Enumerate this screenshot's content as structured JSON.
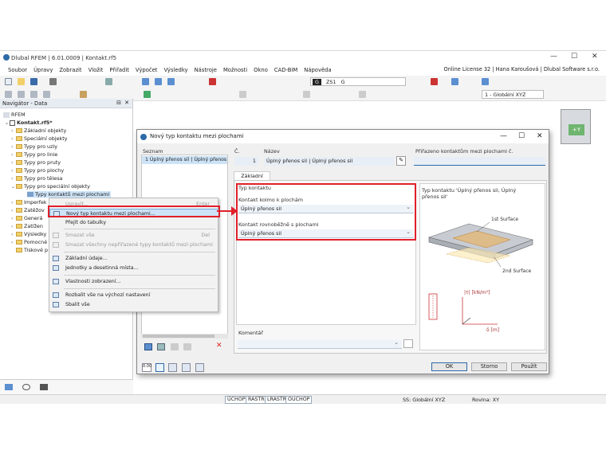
{
  "app": {
    "title": "Dlubal RFEM | 6.01.0009 | Kontakt.rf5",
    "license": "Online License 32 | Hana Karoušová | Dlubal Software s.r.o.",
    "window_controls": [
      "—",
      "☐",
      "✕"
    ]
  },
  "menu": [
    "Soubor",
    "Úpravy",
    "Zobrazit",
    "Vložit",
    "Přiřadit",
    "Výpočet",
    "Výsledky",
    "Nástroje",
    "Možnosti",
    "Okno",
    "CAD-BIM",
    "Nápověda"
  ],
  "toolbar": {
    "load_case": "G",
    "load_case_id": "ZS1",
    "load_case_name": "G",
    "coord_system": "1 - Globální XYZ"
  },
  "navigator": {
    "title": "Navigátor - Data",
    "root": "RFEM",
    "file": "Kontakt.rf5*",
    "items": [
      "Základní objekty",
      "Speciální objekty",
      "Typy pro uzly",
      "Typy pro linie",
      "Typy pro pruty",
      "Typy pro plochy",
      "Typy pro tělesa",
      "Typy pro speciální objekty",
      "Typy kontaktů mezi plochami",
      "Imperfek",
      "Zatěžov",
      "Generá",
      "Zatížen",
      "Výsledky",
      "Pomocné",
      "Tiskové p"
    ]
  },
  "context_menu": {
    "items": [
      {
        "label": "Upravit...",
        "shortcut": "Enter",
        "disabled": true
      },
      {
        "label": "Nový typ kontaktu mezi plochami...",
        "shortcut": "",
        "disabled": false,
        "highlighted": true
      },
      {
        "label": "Přejít do tabulky",
        "shortcut": "",
        "disabled": false
      },
      {
        "label": "Smazat vše",
        "shortcut": "Del",
        "disabled": true
      },
      {
        "label": "Smazat všechny nepřiřazené typy kontaktů mezi plochami",
        "shortcut": "",
        "disabled": true
      },
      {
        "label": "Základní údaje...",
        "shortcut": "",
        "disabled": false
      },
      {
        "label": "Jednotky a desetinná místa...",
        "shortcut": "",
        "disabled": false
      },
      {
        "label": "Vlastnosti zobrazení...",
        "shortcut": "",
        "disabled": false
      },
      {
        "label": "Rozbalit vše na výchozí nastavení",
        "shortcut": "",
        "disabled": false
      },
      {
        "label": "Sbalit vše",
        "shortcut": "",
        "disabled": false
      }
    ]
  },
  "dialog": {
    "title": "Nový typ kontaktu mezi plochami",
    "list_header": "Seznam",
    "list_item": "1  Úplný přenos sil | Úplný přenos",
    "no_label": "Č.",
    "no_value": "1",
    "name_label": "Název",
    "name_value": "Úplný přenos sil | Úplný přenos sil",
    "assigned_label": "Přiřazeno kontaktům mezi plochami č.",
    "tab": "Základní údaje",
    "group_title": "Typ kontaktu",
    "perp_label": "Kontakt kolmo k plochám",
    "perp_value": "Úplný přenos sil",
    "parallel_label": "Kontakt rovnoběžně s plochami",
    "parallel_value": "Úplný přenos sil",
    "comment_label": "Komentář",
    "preview_text": "Typ kontaktu 'Úplný přenos sil, Úplný přenos sil'",
    "surface1": "1st Surface",
    "surface2": "2nd Surface",
    "graph_y": "|τ| [kN/m²]",
    "graph_x": "δ [m]",
    "ok": "OK",
    "cancel": "Storno",
    "apply": "Použít"
  },
  "statusbar": {
    "snap": [
      "ÚCHOP",
      "RASTR",
      "LRASTR",
      "OUCHOP"
    ],
    "cs": "SS: Globální XYZ",
    "plane": "Rovina: XY"
  }
}
